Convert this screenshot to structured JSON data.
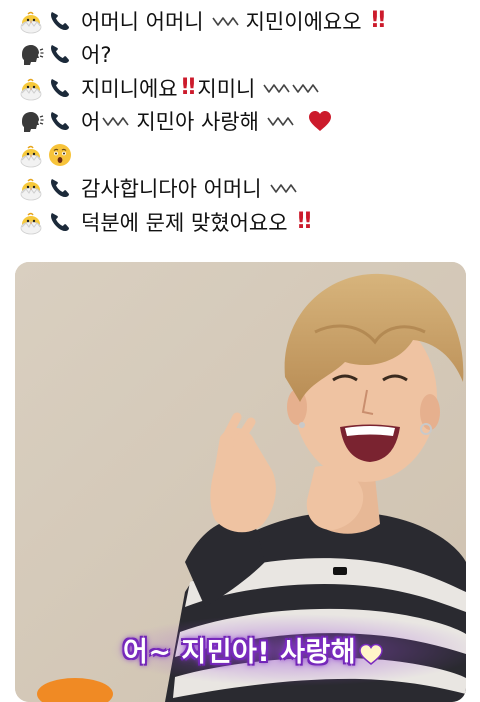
{
  "tweet": {
    "lines": [
      {
        "speaker": "chick-icon",
        "text": "어머니 어머니",
        "wave": true,
        "after": "지민이에요오",
        "bang": "‼️",
        "heart": false
      },
      {
        "speaker": "speaking-head-icon",
        "text": "어?",
        "wave": false,
        "after": "",
        "bang": "",
        "heart": false
      },
      {
        "speaker": "chick-icon",
        "text": "지미니에요",
        "wave": false,
        "after": "지미니",
        "bang": "‼️",
        "heart": false
      },
      {
        "speaker": "speaking-head-icon",
        "text": "어",
        "wave": true,
        "after": "지민아 사랑해",
        "bang": "",
        "heart": true
      },
      {
        "speaker": "chick-icon",
        "text": "",
        "wave": false,
        "after": "",
        "bang": "",
        "heart": false
      },
      {
        "speaker": "chick-icon",
        "text": "감사합니다아 어머니",
        "wave": true,
        "after": "",
        "bang": "",
        "heart": false
      },
      {
        "speaker": "chick-icon",
        "text": "덕분에 문제 맞혔어요오",
        "wave": false,
        "after": "",
        "bang": "‼️",
        "heart": false
      }
    ]
  },
  "l1": {
    "a": "어머니 어머니",
    "b": "지민이에요오",
    "bang": "‼"
  },
  "l2": {
    "a": "어?"
  },
  "l3": {
    "a": "지미니에요",
    "bang": "‼",
    "b": "지미니"
  },
  "l4": {
    "a": "어",
    "b": "지민아 사랑해"
  },
  "l6": {
    "a": "감사합니다아 어머니"
  },
  "l7": {
    "a": "덕분에 문제 맞혔어요오",
    "bang": "‼"
  },
  "media": {
    "caption": "어~ 지민아! 사랑해",
    "caption_color": "#ffffff",
    "caption_glow": "#7a2bbf"
  },
  "colors": {
    "text": "#111111",
    "exclaim": "#cc1b2c",
    "heart": "#cc1b2c",
    "background": "#ffffff"
  }
}
